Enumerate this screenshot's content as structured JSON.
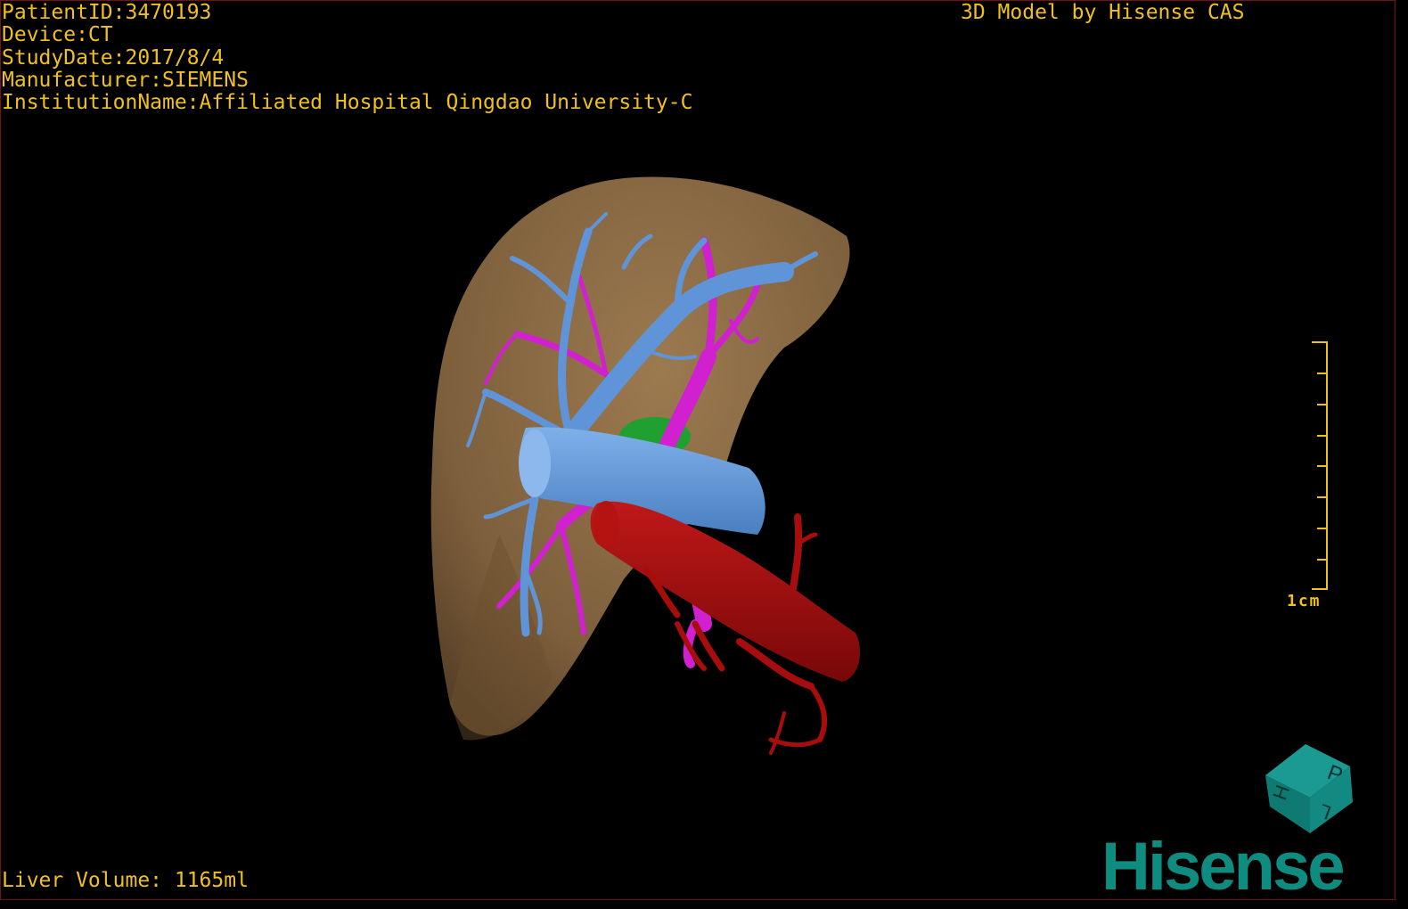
{
  "overlay": {
    "patient_id": "PatientID:3470193",
    "device": "Device:CT",
    "study_date": "StudyDate:2017/8/4",
    "manufacturer": "Manufacturer:SIEMENS",
    "institution": "InstitutionName:Affiliated Hospital Qingdao University-C",
    "credit": "3D Model by Hisense CAS",
    "liver_volume": "Liver Volume: 1165ml"
  },
  "scale_bar": {
    "label": "1cm"
  },
  "orientation_cube": {
    "face_letters": [
      "P",
      "H",
      "L"
    ]
  },
  "logo": {
    "text": "Hisense"
  },
  "colors": {
    "text": "#f0c020",
    "liver": "#8a6a44",
    "hepatic_vein": "#5f95d8",
    "portal_vein": "#d020d0",
    "artery": "#a80d0d",
    "gallbladder": "#20a030",
    "brand": "#0f8c80"
  }
}
